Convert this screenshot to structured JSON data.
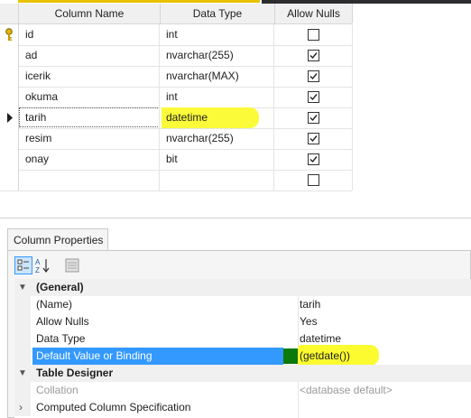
{
  "grid": {
    "headers": {
      "column_name": "Column Name",
      "data_type": "Data Type",
      "allow_nulls": "Allow Nulls"
    },
    "rows": [
      {
        "name": "id",
        "type": "int",
        "allow_nulls": false,
        "primary_key": true
      },
      {
        "name": "ad",
        "type": "nvarchar(255)",
        "allow_nulls": true
      },
      {
        "name": "icerik",
        "type": "nvarchar(MAX)",
        "allow_nulls": true
      },
      {
        "name": "okuma",
        "type": "int",
        "allow_nulls": true
      },
      {
        "name": "tarih",
        "type": "datetime",
        "allow_nulls": true,
        "current": true,
        "highlighted": true
      },
      {
        "name": "resim",
        "type": "nvarchar(255)",
        "allow_nulls": true
      },
      {
        "name": "onay",
        "type": "bit",
        "allow_nulls": true
      },
      {
        "name": "",
        "type": "",
        "allow_nulls": false
      }
    ]
  },
  "properties": {
    "tab_label": "Column Properties",
    "general_label": "(General)",
    "name_label": "(Name)",
    "name_value": "tarih",
    "allow_nulls_label": "Allow Nulls",
    "allow_nulls_value": "Yes",
    "data_type_label": "Data Type",
    "data_type_value": "datetime",
    "default_label": "Default Value or Binding",
    "default_value": "(getdate())",
    "table_designer_label": "Table Designer",
    "collation_label": "Collation",
    "collation_value": "<database default>",
    "computed_label": "Computed Column Specification"
  },
  "colors": {
    "highlight": "#fbfb2f",
    "selection": "#3399ff",
    "green_marker": "#0b7a0b"
  },
  "icons": [
    "primary-key-icon",
    "current-row-arrow-icon",
    "checkbox-checked-icon",
    "categorized-icon",
    "alphabetical-icon",
    "property-pages-icon",
    "expand-chevron-icon"
  ]
}
